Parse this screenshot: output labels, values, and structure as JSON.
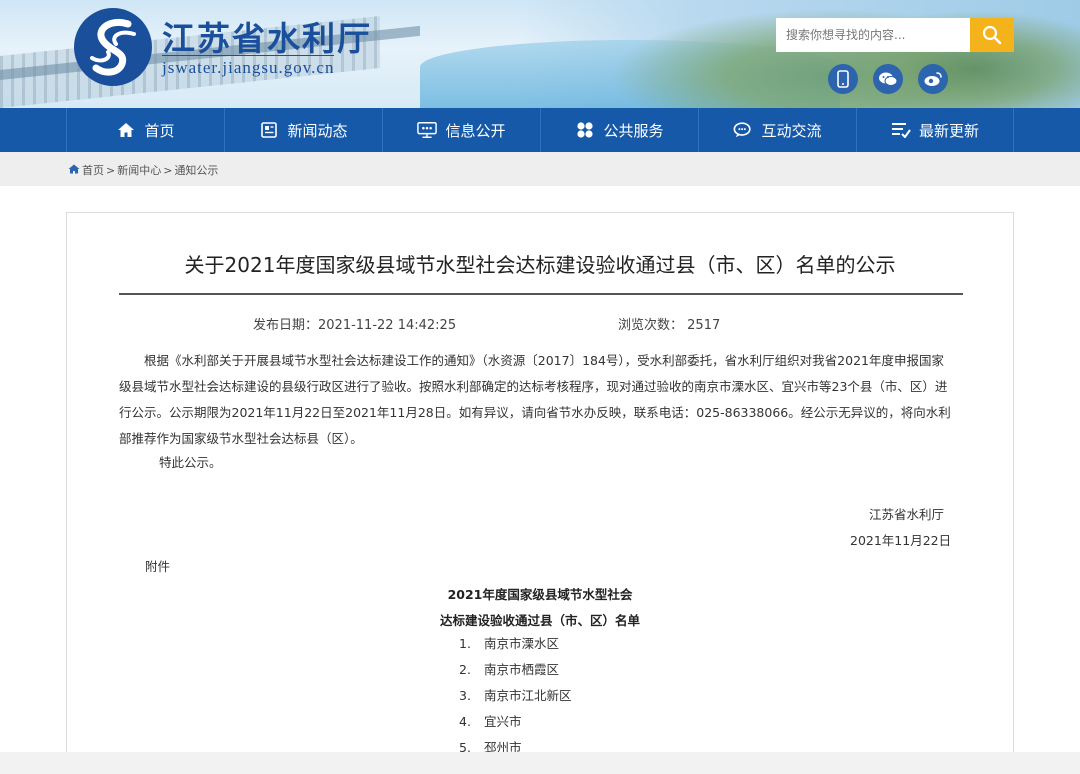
{
  "header": {
    "site_title": "江苏省水利厅",
    "site_domain": "jswater.jiangsu.gov.cn",
    "search_placeholder": "搜索你想寻找的内容...",
    "social_icons": [
      "mobile-icon",
      "wechat-icon",
      "weibo-icon"
    ]
  },
  "nav": {
    "items": [
      {
        "label": "首页",
        "icon": "home-icon"
      },
      {
        "label": "新闻动态",
        "icon": "news-icon"
      },
      {
        "label": "信息公开",
        "icon": "info-icon"
      },
      {
        "label": "公共服务",
        "icon": "service-icon"
      },
      {
        "label": "互动交流",
        "icon": "chat-icon"
      },
      {
        "label": "最新更新",
        "icon": "update-icon"
      }
    ]
  },
  "breadcrumb": {
    "home": "首页",
    "sep": ">",
    "level1": "新闻中心",
    "level2": "通知公示"
  },
  "article": {
    "title": "关于2021年度国家级县域节水型社会达标建设验收通过县（市、区）名单的公示",
    "publish_label": "发布日期：",
    "publish_date": "2021-11-22 14:42:25",
    "views_label": "浏览次数：",
    "views": "2517",
    "body": "根据《水利部关于开展县域节水型社会达标建设工作的通知》（水资源〔2017〕184号），受水利部委托，省水利厅组织对我省2021年度申报国家级县域节水型社会达标建设的县级行政区进行了验收。按照水利部确定的达标考核程序，现对通过验收的南京市溧水区、宜兴市等23个县（市、区）进行公示。公示期限为2021年11月22日至2021年11月28日。如有异议，请向省节水办反映，联系电话：025-86338066。经公示无异议的，将向水利部推荐作为国家级节水型社会达标县（区）。",
    "closing": "特此公示。",
    "signer": "江苏省水利厅",
    "sign_date": "2021年11月22日",
    "attachment_label": "附件",
    "list_title_line1": "2021年度国家级县域节水型社会",
    "list_title_line2": "达标建设验收通过县（市、区）名单",
    "counties": [
      {
        "num": "1.",
        "name": "南京市溧水区"
      },
      {
        "num": "2.",
        "name": "南京市栖霞区"
      },
      {
        "num": "3.",
        "name": "南京市江北新区"
      },
      {
        "num": "4.",
        "name": "宜兴市"
      },
      {
        "num": "5.",
        "name": "邳州市"
      }
    ]
  },
  "colors": {
    "brand_blue": "#1a4f9c",
    "nav_blue": "#1559a8",
    "search_button": "#f5b31b",
    "breadcrumb_bg": "#eeeeee"
  }
}
